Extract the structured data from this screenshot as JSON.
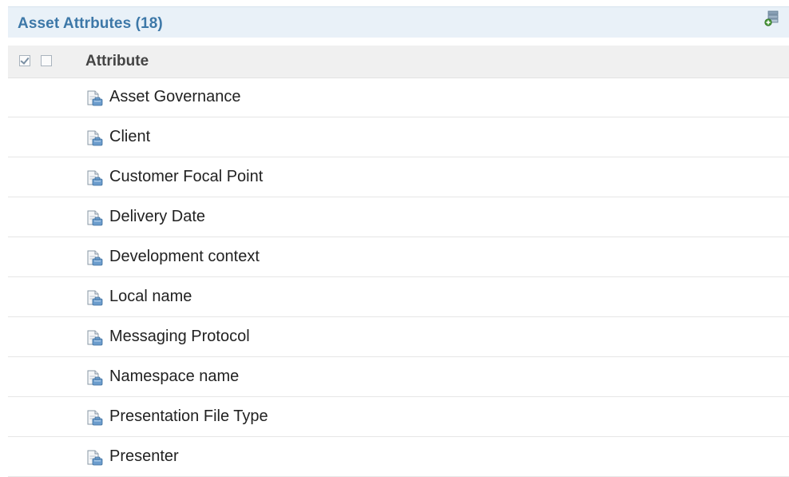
{
  "panel": {
    "title": "Asset Attrbutes (18)",
    "header_action_icon": "add-attribute-icon"
  },
  "table": {
    "column_header": "Attribute",
    "select_all_checked": true,
    "select_none_checked": false,
    "row_icon": "attribute-document-icon",
    "rows": [
      {
        "label": "Asset Governance"
      },
      {
        "label": "Client"
      },
      {
        "label": "Customer Focal Point"
      },
      {
        "label": "Delivery Date"
      },
      {
        "label": "Development context"
      },
      {
        "label": "Local name"
      },
      {
        "label": "Messaging Protocol"
      },
      {
        "label": "Namespace name"
      },
      {
        "label": "Presentation File Type"
      },
      {
        "label": "Presenter"
      }
    ]
  },
  "colors": {
    "header_bg": "#e9f1f8",
    "title_color": "#3d78a8",
    "column_header_bg": "#f0f0f0"
  }
}
